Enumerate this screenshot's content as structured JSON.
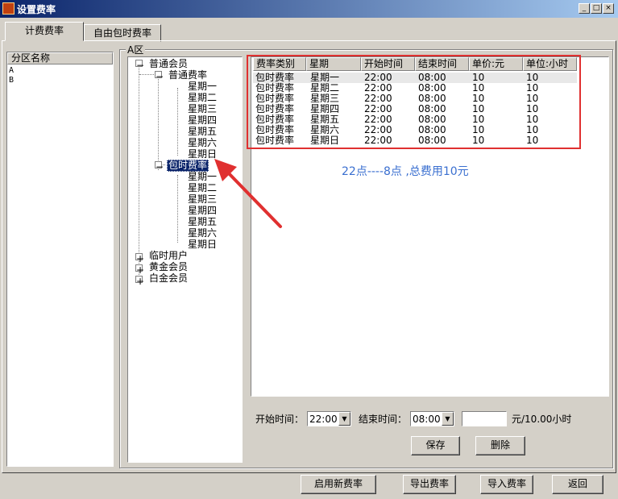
{
  "window": {
    "title": "设置费率"
  },
  "tabs": [
    {
      "label": "计费费率"
    },
    {
      "label": "自由包时费率"
    }
  ],
  "zones": {
    "header": "分区名称",
    "items": [
      {
        "label": "A"
      },
      {
        "label": "B"
      }
    ]
  },
  "group_title": "A区",
  "tree": {
    "member": "普通会员",
    "normal_rate": "普通费率",
    "hourly_rate": "包时费率",
    "days": [
      "星期一",
      "星期二",
      "星期三",
      "星期四",
      "星期五",
      "星期六",
      "星期日"
    ],
    "temp_user": "临时用户",
    "gold": "黄金会员",
    "platinum": "白金会员"
  },
  "table": {
    "headers": [
      "费率类别",
      "星期",
      "开始时间",
      "结束时间",
      "单价:元",
      "单位:小时"
    ],
    "rows": [
      [
        "包时费率",
        "星期一",
        "22:00",
        "08:00",
        "10",
        "10"
      ],
      [
        "包时费率",
        "星期二",
        "22:00",
        "08:00",
        "10",
        "10"
      ],
      [
        "包时费率",
        "星期三",
        "22:00",
        "08:00",
        "10",
        "10"
      ],
      [
        "包时费率",
        "星期四",
        "22:00",
        "08:00",
        "10",
        "10"
      ],
      [
        "包时费率",
        "星期五",
        "22:00",
        "08:00",
        "10",
        "10"
      ],
      [
        "包时费率",
        "星期六",
        "22:00",
        "08:00",
        "10",
        "10"
      ],
      [
        "包时费率",
        "星期日",
        "22:00",
        "08:00",
        "10",
        "10"
      ]
    ]
  },
  "annotation": "22点----8点 ,总费用10元",
  "form": {
    "start_label": "开始时间：",
    "start_value": "22:00",
    "end_label": "结束时间：",
    "end_value": "08:00",
    "price_value": "",
    "unit_label": "元/10.00小时"
  },
  "buttons": {
    "save": "保存",
    "delete": "删除",
    "enable": "启用新费率",
    "export": "导出费率",
    "import": "导入费率",
    "back": "返回"
  },
  "colors": {
    "titlebar": "#0a246a",
    "highlight_box": "#e03030",
    "selection": "#0a246a",
    "annotation_text": "#3a6fd0"
  }
}
